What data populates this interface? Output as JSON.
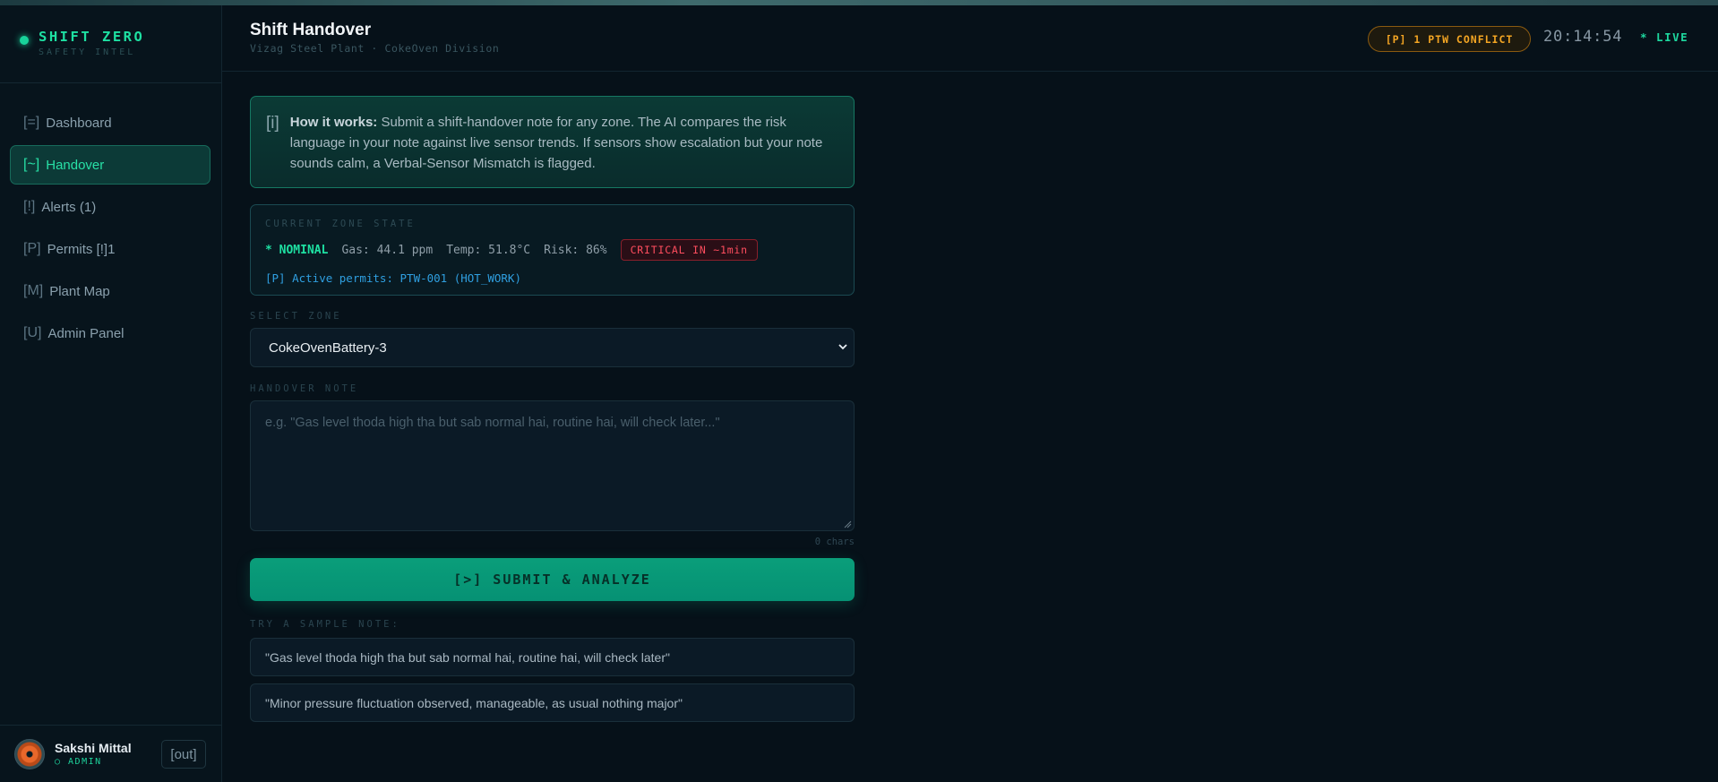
{
  "brand": {
    "name": "SHIFT ZERO",
    "subtitle": "SAFETY INTEL"
  },
  "sidebar": {
    "items": [
      {
        "icon": "[=]",
        "label": "Dashboard"
      },
      {
        "icon": "[~]",
        "label": "Handover",
        "active": true
      },
      {
        "icon": "[!]",
        "label": "Alerts (1)"
      },
      {
        "icon": "[P]",
        "label": "Permits [!]1"
      },
      {
        "icon": "[M]",
        "label": "Plant Map"
      },
      {
        "icon": "[U]",
        "label": "Admin Panel"
      }
    ]
  },
  "user": {
    "name": "Sakshi Mittal",
    "role": "○ ADMIN",
    "logout_label": "[out]"
  },
  "header": {
    "title": "Shift Handover",
    "subtitle": "Vizag Steel Plant · CokeOven Division",
    "ptw_badge": "[P] 1 PTW CONFLICT",
    "clock": "20:14:54",
    "live": "* LIVE"
  },
  "info": {
    "icon": "[i]",
    "heading": "How it works:",
    "text": " Submit a shift-handover note for any zone. The AI compares the risk language in your note against live sensor trends. If sensors show escalation but your note sounds calm, a Verbal-Sensor Mismatch is flagged."
  },
  "zone_state": {
    "label": "CURRENT ZONE STATE",
    "status": "* NOMINAL",
    "gas": "Gas: 44.1 ppm",
    "temp": "Temp: 51.8°C",
    "risk": "Risk: 86%",
    "critical": "CRITICAL IN ~1min",
    "permits": "[P] Active permits: PTW-001 (HOT_WORK)"
  },
  "form": {
    "zone_label": "SELECT ZONE",
    "zone_value": "CokeOvenBattery-3",
    "note_label": "HANDOVER NOTE",
    "note_placeholder": "e.g. \"Gas level thoda high tha but sab normal hai, routine hai, will check later...\"",
    "char_count": "0 chars",
    "submit_label": "[>] SUBMIT & ANALYZE"
  },
  "samples": {
    "label": "TRY A SAMPLE NOTE:",
    "items": [
      "\"Gas level thoda high tha but sab normal hai, routine hai, will check later\"",
      "\"Minor pressure fluctuation observed, manageable, as usual nothing major\""
    ]
  },
  "colors": {
    "accent": "#1ee0a2",
    "warning": "#f5a623",
    "critical": "#ff4d5e",
    "permit_link": "#2f9fe0",
    "background": "#061119"
  }
}
